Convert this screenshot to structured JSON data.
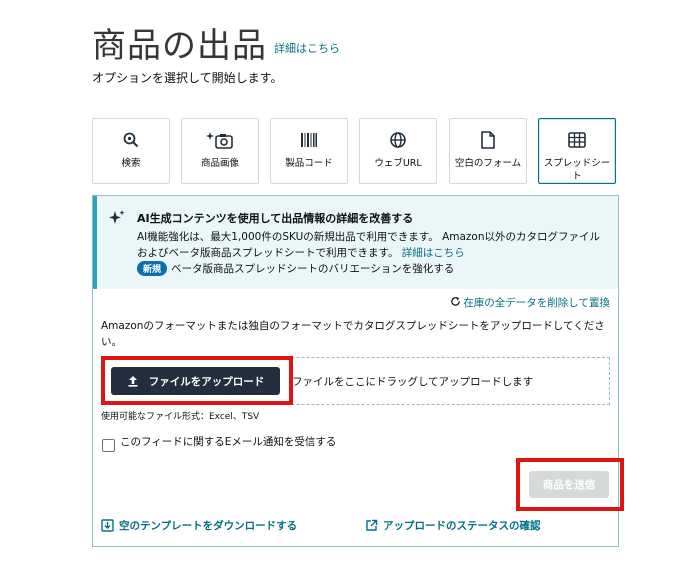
{
  "header": {
    "title": "商品の出品",
    "learn_more": "詳細はこちら",
    "subtitle": "オプションを選択して開始します。"
  },
  "options": [
    {
      "label": "検索",
      "icon": "search-icon"
    },
    {
      "label": "商品画像",
      "icon": "camera-sparkle-icon"
    },
    {
      "label": "製品コード",
      "icon": "barcode-icon"
    },
    {
      "label": "ウェブURL",
      "icon": "globe-icon"
    },
    {
      "label": "空白のフォーム",
      "icon": "document-icon"
    },
    {
      "label": "スプレッドシート",
      "icon": "spreadsheet-icon",
      "selected": true
    }
  ],
  "banner": {
    "title": "AI生成コンテンツを使用して出品情報の詳細を改善する",
    "description": "AI機能強化は、最大1,000件のSKUの新規出品で利用できます。 Amazon以外のカタログファイルおよびベータ版商品スプレッドシートで利用できます。",
    "learn_more": "詳細はこちら",
    "new_badge": "新規",
    "new_text": "ベータ版商品スプレッドシートのバリエーションを強化する"
  },
  "upload": {
    "replace_link": "在庫の全データを削除して置換",
    "instructions": "Amazonのフォーマットまたは独自のフォーマットでカタログスプレッドシートをアップロードしてください。",
    "upload_button": "ファイルをアップロード",
    "drag_text": "ファイルをここにドラッグしてアップロードします",
    "formats": "使用可能なファイル形式：Excel、TSV",
    "email_checkbox_label": "このフィードに関するEメール通知を受信する",
    "email_checked": false,
    "submit_button": "商品を送信"
  },
  "footer_links": {
    "download_template": "空のテンプレートをダウンロードする",
    "upload_status": "アップロードのステータスの確認"
  },
  "colors": {
    "teal_link": "#007185",
    "dark_button": "#232f3e",
    "highlight_red": "#e11414",
    "banner_bg": "#eaf6f8",
    "new_badge": "#0b6fb3"
  }
}
